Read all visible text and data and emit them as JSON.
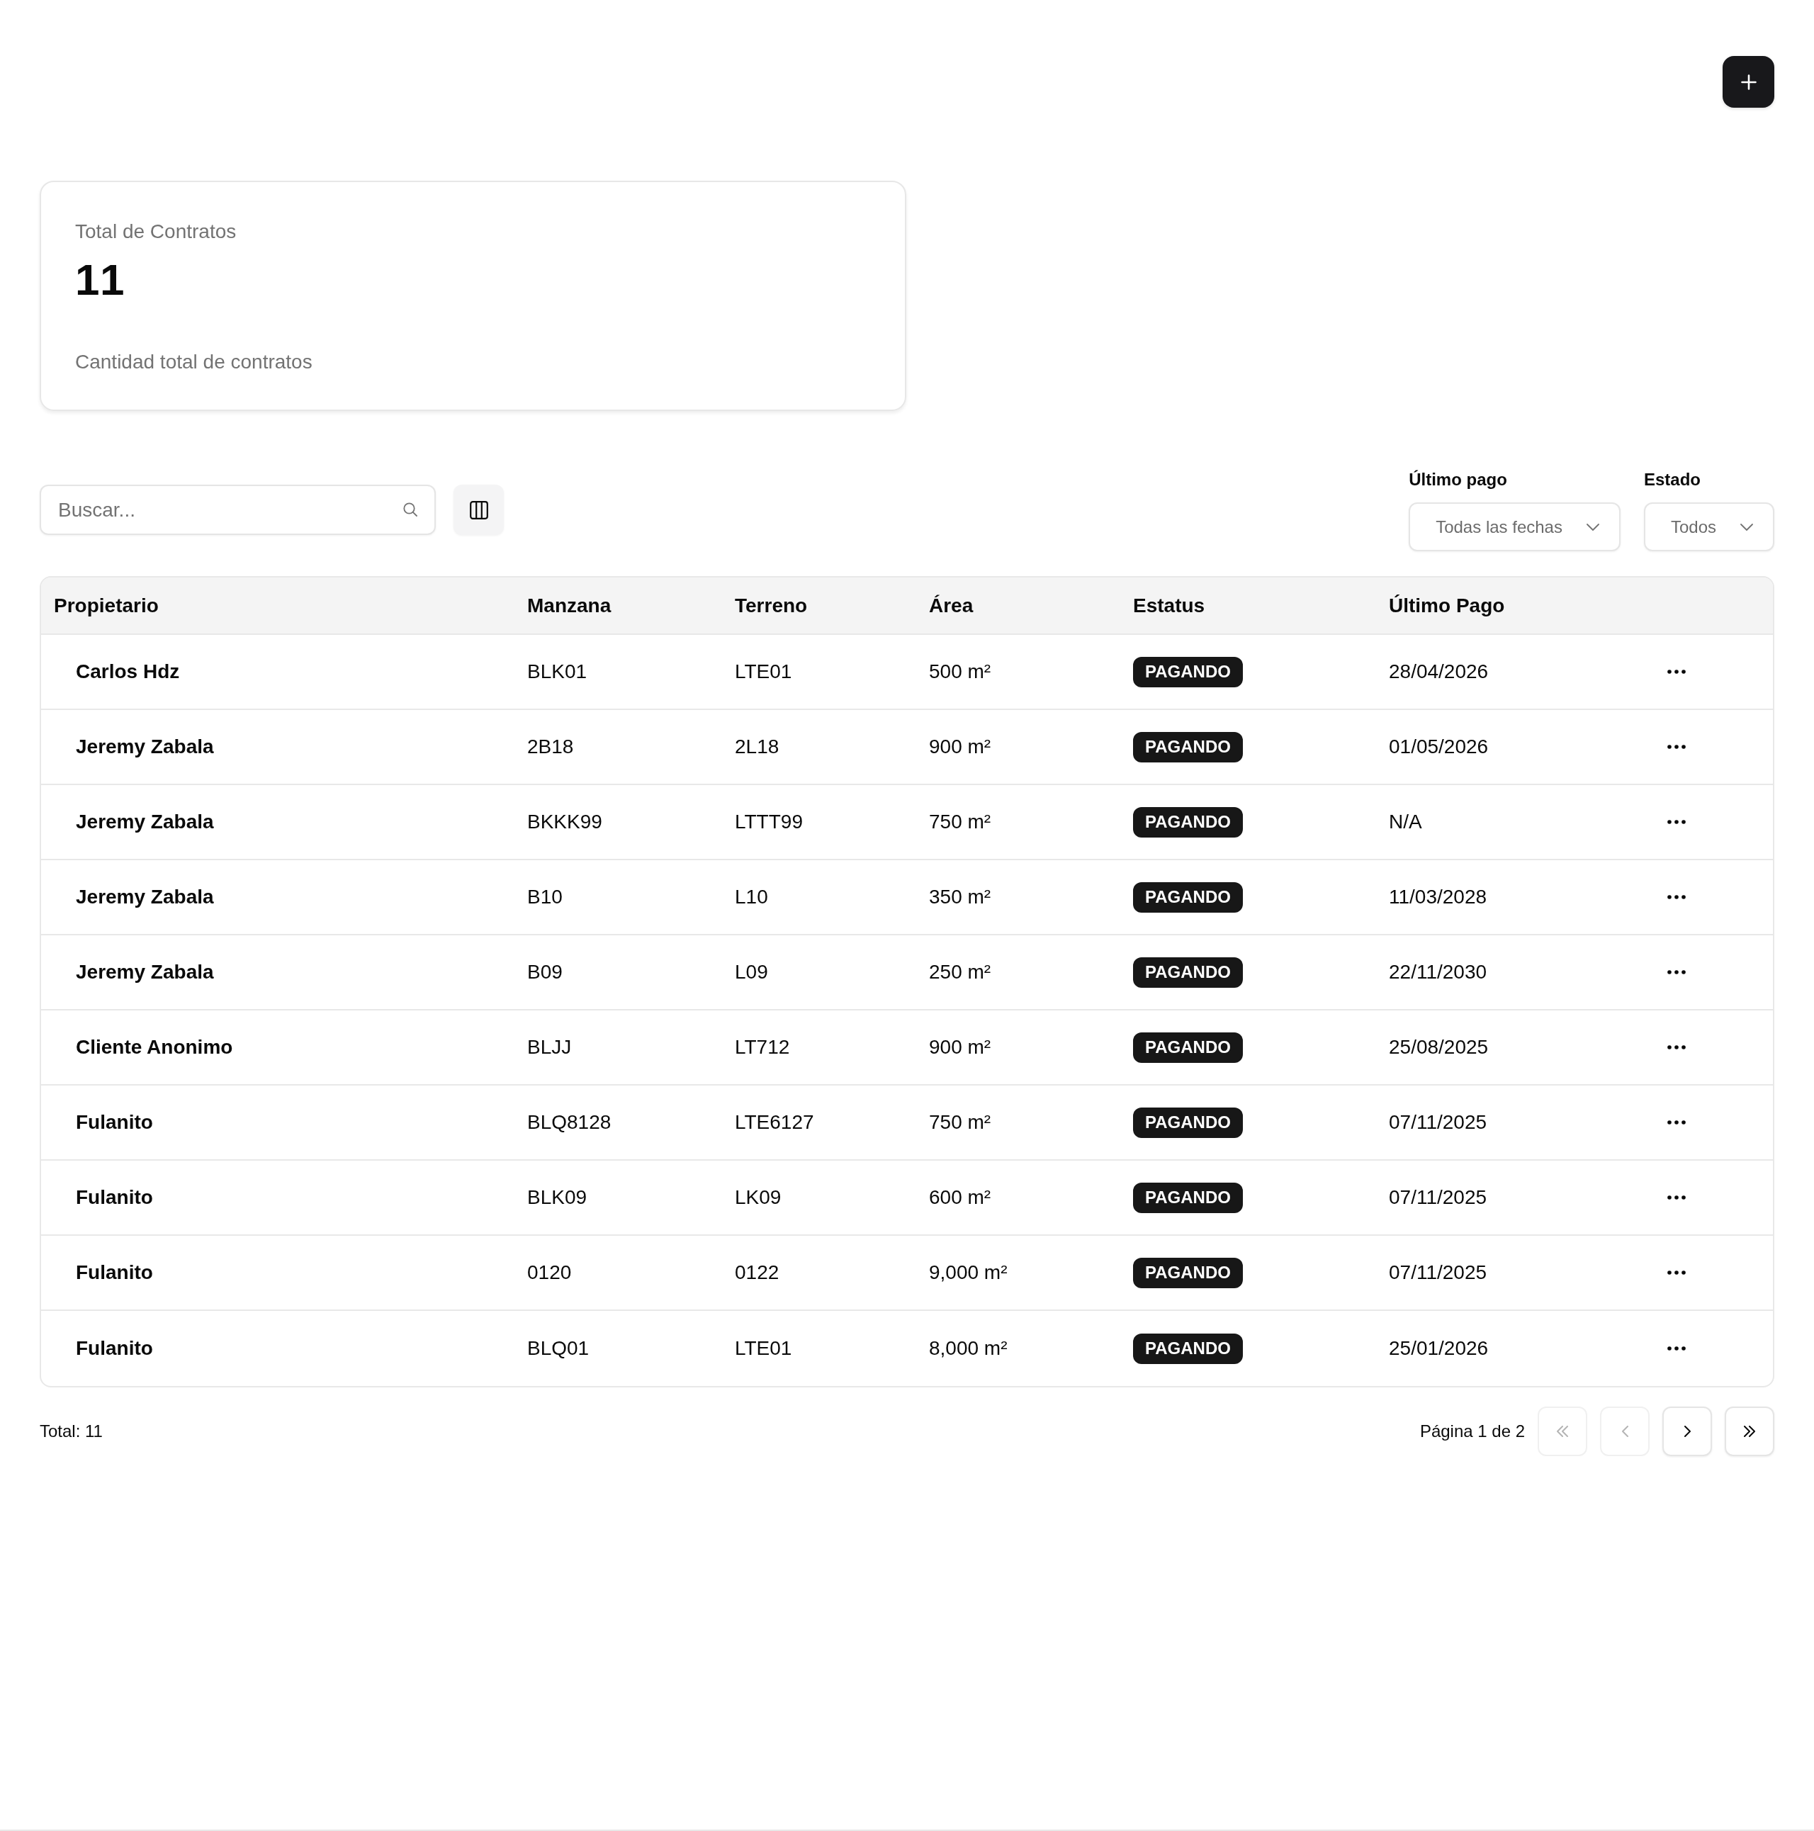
{
  "stat_card": {
    "title": "Total de Contratos",
    "value": "11",
    "description": "Cantidad total de contratos"
  },
  "toolbar": {
    "search": {
      "placeholder": "Buscar..."
    },
    "filters": [
      {
        "label": "Último pago",
        "value": "Todas las fechas"
      },
      {
        "label": "Estado",
        "value": "Todos"
      }
    ]
  },
  "table": {
    "columns": [
      "Propietario",
      "Manzana",
      "Terreno",
      "Área",
      "Estatus",
      "Último Pago"
    ],
    "rows": [
      {
        "owner": "Carlos Hdz",
        "block": "BLK01",
        "lot": "LTE01",
        "area": "500 m²",
        "status": "PAGANDO",
        "last_payment": "28/04/2026"
      },
      {
        "owner": "Jeremy Zabala",
        "block": "2B18",
        "lot": "2L18",
        "area": "900 m²",
        "status": "PAGANDO",
        "last_payment": "01/05/2026"
      },
      {
        "owner": "Jeremy Zabala",
        "block": "BKKK99",
        "lot": "LTTT99",
        "area": "750 m²",
        "status": "PAGANDO",
        "last_payment": "N/A"
      },
      {
        "owner": "Jeremy Zabala",
        "block": "B10",
        "lot": "L10",
        "area": "350 m²",
        "status": "PAGANDO",
        "last_payment": "11/03/2028"
      },
      {
        "owner": "Jeremy Zabala",
        "block": "B09",
        "lot": "L09",
        "area": "250 m²",
        "status": "PAGANDO",
        "last_payment": "22/11/2030"
      },
      {
        "owner": "Cliente Anonimo",
        "block": "BLJJ",
        "lot": "LT712",
        "area": "900 m²",
        "status": "PAGANDO",
        "last_payment": "25/08/2025"
      },
      {
        "owner": "Fulanito",
        "block": "BLQ8128",
        "lot": "LTE6127",
        "area": "750 m²",
        "status": "PAGANDO",
        "last_payment": "07/11/2025"
      },
      {
        "owner": "Fulanito",
        "block": "BLK09",
        "lot": "LK09",
        "area": "600 m²",
        "status": "PAGANDO",
        "last_payment": "07/11/2025"
      },
      {
        "owner": "Fulanito",
        "block": "0120",
        "lot": "0122",
        "area": "9,000 m²",
        "status": "PAGANDO",
        "last_payment": "07/11/2025"
      },
      {
        "owner": "Fulanito",
        "block": "BLQ01",
        "lot": "LTE01",
        "area": "8,000 m²",
        "status": "PAGANDO",
        "last_payment": "25/01/2026"
      }
    ]
  },
  "footer": {
    "total": "Total: 11",
    "page_info": "Página 1 de 2",
    "pagination": [
      {
        "kind": "first",
        "disabled": true
      },
      {
        "kind": "previous",
        "disabled": true
      },
      {
        "kind": "next",
        "disabled": false
      },
      {
        "kind": "last",
        "disabled": false
      }
    ]
  }
}
